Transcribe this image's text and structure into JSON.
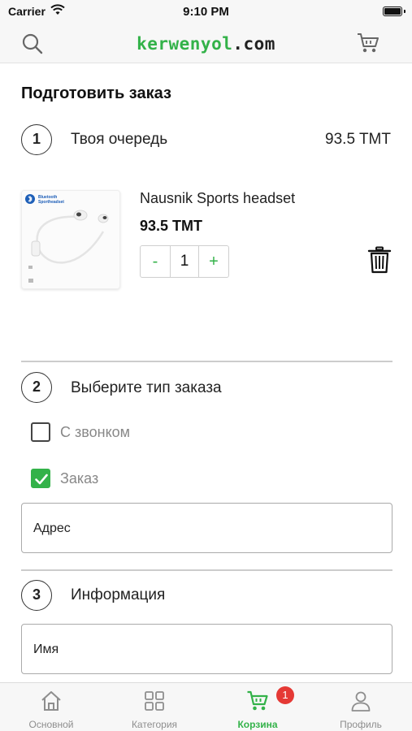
{
  "status_bar": {
    "carrier": "Carrier",
    "time": "9:10 PM"
  },
  "header": {
    "brand_main": "kerwenyol",
    "brand_tld": ".com",
    "search_icon": "search-icon",
    "cart_icon": "cart-icon"
  },
  "page": {
    "title": "Подготовить заказ"
  },
  "step1": {
    "number": "1",
    "label": "Твоя очередь",
    "total": "93.5 TMT"
  },
  "product": {
    "name": "Nausnik Sports headset",
    "price": "93.5 TMT",
    "quantity": "1",
    "decrement_label": "-",
    "increment_label": "+",
    "image_text_line1": "Bluetooth",
    "image_text_line2": "Sportheadset"
  },
  "step2": {
    "number": "2",
    "label": "Выберите тип заказа",
    "options": [
      {
        "label": "С звонком",
        "checked": false
      },
      {
        "label": "Заказ",
        "checked": true
      }
    ],
    "address_label": "Адрес"
  },
  "step3": {
    "number": "3",
    "label": "Информация",
    "name_label": "Имя"
  },
  "tabbar": {
    "tabs": [
      {
        "label": "Основной",
        "icon": "home-icon",
        "active": false
      },
      {
        "label": "Категория",
        "icon": "grid-icon",
        "active": false
      },
      {
        "label": "Корзина",
        "icon": "cart-icon",
        "active": true
      },
      {
        "label": "Профиль",
        "icon": "profile-icon",
        "active": false
      }
    ],
    "cart_badge": "1"
  },
  "colors": {
    "accent": "#33b249",
    "badge": "#e53935",
    "header_bg": "#f7f7f7"
  }
}
